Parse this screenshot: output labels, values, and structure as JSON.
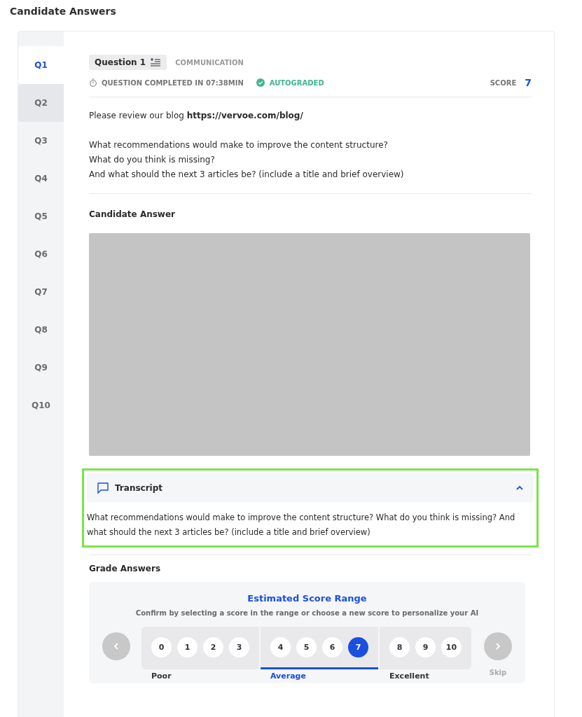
{
  "page_title": "Candidate Answers",
  "questions": [
    {
      "label": "Q1",
      "selected": true,
      "highlighted": false
    },
    {
      "label": "Q2",
      "selected": false,
      "highlighted": true
    },
    {
      "label": "Q3",
      "selected": false,
      "highlighted": false
    },
    {
      "label": "Q4",
      "selected": false,
      "highlighted": false
    },
    {
      "label": "Q5",
      "selected": false,
      "highlighted": false
    },
    {
      "label": "Q6",
      "selected": false,
      "highlighted": false
    },
    {
      "label": "Q7",
      "selected": false,
      "highlighted": false
    },
    {
      "label": "Q8",
      "selected": false,
      "highlighted": false
    },
    {
      "label": "Q9",
      "selected": false,
      "highlighted": false
    },
    {
      "label": "Q10",
      "selected": false,
      "highlighted": false
    }
  ],
  "question": {
    "title": "Question 1",
    "category": "COMMUNICATION",
    "completed": "QUESTION COMPLETED IN 07:38MIN",
    "status": "AUTOGRADED",
    "score_label": "SCORE",
    "score": "7",
    "body": [
      [
        "Please review our blog **https://vervoe.com/blog/**"
      ],
      [
        "What recommendations would make to improve the content structure?",
        "What do you think is missing?",
        "And what should the next 3 articles be? (include a title and brief overview)"
      ]
    ]
  },
  "answer": {
    "heading": "Candidate Answer",
    "media": {
      "kind": "blank"
    }
  },
  "transcript": {
    "title": "Transcript",
    "expanded": true,
    "highlighted": true,
    "text": "What recommendations would make to improve the content structure? What do you think is missing? And what should the next 3 articles be? (include a title and brief overview)"
  },
  "grade": {
    "heading": "Grade Answers",
    "title": "Estimated Score Range",
    "subtitle": "Confirm by selecting a score in the range or choose a new score to personalize your AI",
    "groups": [
      {
        "label": "Poor",
        "selected": false,
        "scores": [
          {
            "value": "0",
            "selected": false
          },
          {
            "value": "1",
            "selected": false
          },
          {
            "value": "2",
            "selected": false
          },
          {
            "value": "3",
            "selected": false
          }
        ]
      },
      {
        "label": "Average",
        "selected": true,
        "scores": [
          {
            "value": "4",
            "selected": false
          },
          {
            "value": "5",
            "selected": false
          },
          {
            "value": "6",
            "selected": false
          },
          {
            "value": "7",
            "selected": true
          }
        ]
      },
      {
        "label": "Excellent",
        "selected": false,
        "scores": [
          {
            "value": "8",
            "selected": false
          },
          {
            "value": "9",
            "selected": false
          },
          {
            "value": "10",
            "selected": false
          }
        ]
      }
    ],
    "skip": "Skip"
  }
}
